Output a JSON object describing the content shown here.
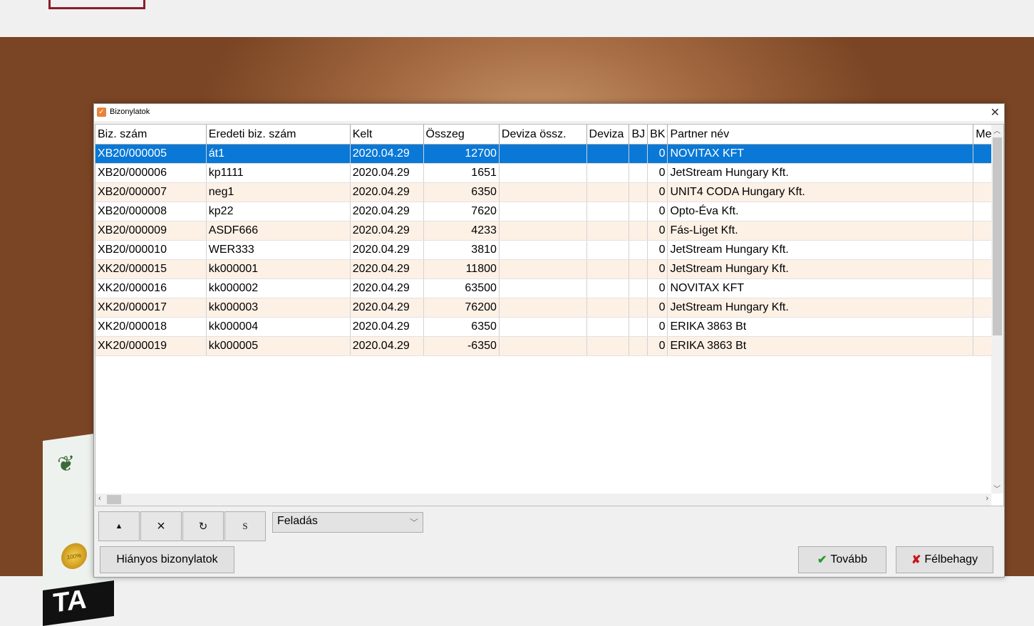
{
  "dialog": {
    "title": "Bizonylatok",
    "close_glyph": "✕",
    "icon": "checkbox-app-icon"
  },
  "grid": {
    "columns": [
      "Biz. szám",
      "Eredeti biz. szám",
      "Kelt",
      "Összeg",
      "Deviza össz.",
      "Deviza",
      "BJ",
      "BK",
      "Partner név",
      "Megj"
    ],
    "rows": [
      [
        "XB20/000005",
        "át1",
        "2020.04.29",
        "12700",
        "",
        "",
        "",
        "0",
        "NOVITAX KFT",
        ""
      ],
      [
        "XB20/000006",
        "kp1111",
        "2020.04.29",
        "1651",
        "",
        "",
        "",
        "0",
        "JetStream Hungary Kft.",
        ""
      ],
      [
        "XB20/000007",
        "neg1",
        "2020.04.29",
        "6350",
        "",
        "",
        "",
        "0",
        "UNIT4 CODA Hungary Kft.",
        ""
      ],
      [
        "XB20/000008",
        "kp22",
        "2020.04.29",
        "7620",
        "",
        "",
        "",
        "0",
        "Opto-Éva Kft.",
        ""
      ],
      [
        "XB20/000009",
        "ASDF666",
        "2020.04.29",
        "4233",
        "",
        "",
        "",
        "0",
        "Fás-Liget Kft.",
        ""
      ],
      [
        "XB20/000010",
        "WER333",
        "2020.04.29",
        "3810",
        "",
        "",
        "",
        "0",
        "JetStream Hungary Kft.",
        ""
      ],
      [
        "XK20/000015",
        "kk000001",
        "2020.04.29",
        "11800",
        "",
        "",
        "",
        "0",
        "JetStream Hungary Kft.",
        ""
      ],
      [
        "XK20/000016",
        "kk000002",
        "2020.04.29",
        "63500",
        "",
        "",
        "",
        "0",
        "NOVITAX KFT",
        ""
      ],
      [
        "XK20/000017",
        "kk000003",
        "2020.04.29",
        "76200",
        "",
        "",
        "",
        "0",
        "JetStream Hungary Kft.",
        ""
      ],
      [
        "XK20/000018",
        "kk000004",
        "2020.04.29",
        "6350",
        "",
        "",
        "",
        "0",
        "ERIKA 3863 Bt",
        ""
      ],
      [
        "XK20/000019",
        "kk000005",
        "2020.04.29",
        "-6350",
        "",
        "",
        "",
        "0",
        "ERIKA 3863 Bt",
        ""
      ]
    ],
    "selected_row": 0
  },
  "nav": {
    "up_glyph": "▲",
    "delete_glyph": "×",
    "refresh_glyph": "↻",
    "s_label": "S"
  },
  "combo": {
    "value": "Feladás"
  },
  "buttons": {
    "missing_docs": "Hiányos bizonylatok",
    "next": "Tovább",
    "cancel": "Félbehagy"
  },
  "background": {
    "box_logo": "TA",
    "seal_text": "100%"
  },
  "colors": {
    "selection": "#0a78d7",
    "alt_row": "#fdf1e6",
    "ok": "#2a9a2a",
    "cancel": "#c8141c"
  }
}
